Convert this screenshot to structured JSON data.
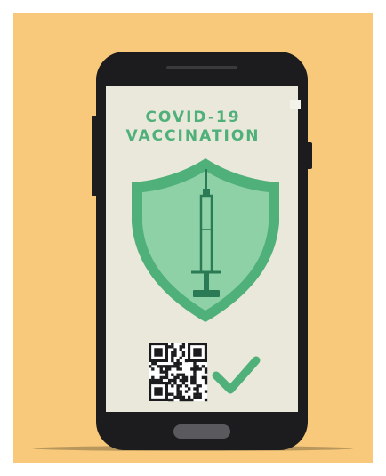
{
  "screen": {
    "title_line1": "COVID-19",
    "title_line2": "VACCINATION"
  },
  "colors": {
    "background": "#f8c97a",
    "phone_body": "#1c1c1e",
    "screen": "#e9e8da",
    "accent_green": "#4fb07a",
    "shield_fill": "#8fd1a7",
    "syringe": "#2a7a55"
  },
  "icons": [
    "phone-illustration",
    "shield-icon",
    "syringe-icon",
    "qr-code-icon",
    "checkmark-icon",
    "home-button"
  ]
}
